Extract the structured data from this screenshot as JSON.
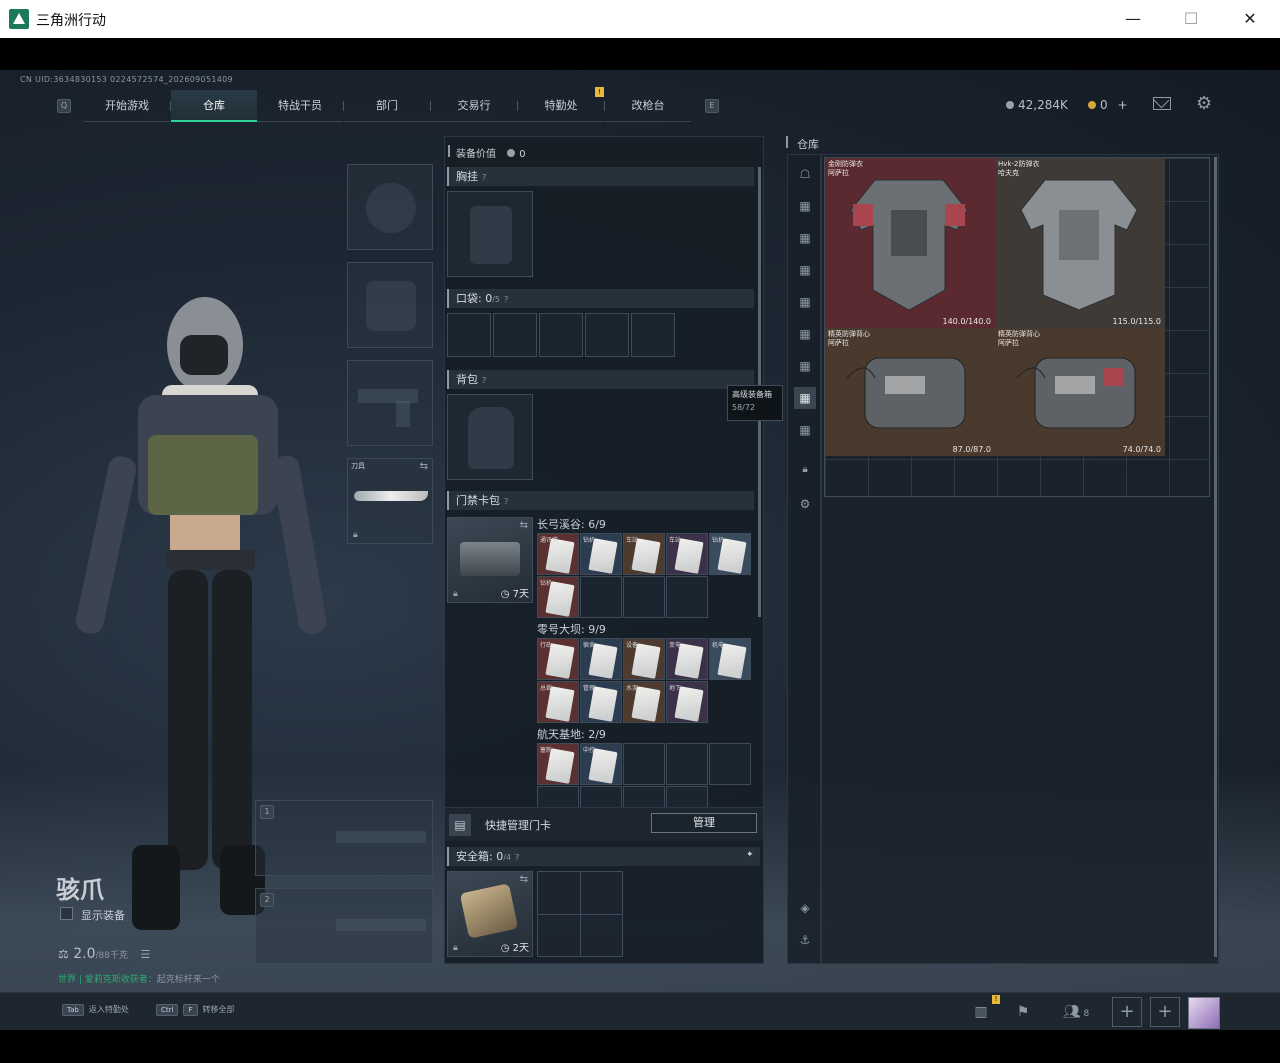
{
  "window": {
    "title": "三角洲行动",
    "controls": {
      "minimize": "—",
      "maximize": "☐",
      "close": "✕"
    }
  },
  "uid": "CN UID:3634830153 0224572574_202609051409",
  "nav": {
    "left_key": "Q",
    "right_key": "E",
    "tabs": [
      "开始游戏",
      "仓库",
      "特战干员",
      "部门",
      "交易行",
      "特勤处",
      "改枪台"
    ],
    "active_tab": "仓库",
    "notify_badge": "!"
  },
  "currency": {
    "hafcoin": "42,284K",
    "coupons": "0",
    "plus": "+"
  },
  "operator": {
    "name": "骇爪",
    "show_gear_label": "显示装备",
    "weight": "2.0",
    "weight_max": "/88千克",
    "chat_line_green": "世界 | 爱莉克斯收获者：",
    "chat_line_gray": "起克标杆来一个"
  },
  "slots": {
    "melee_label": "刀具",
    "weapon_slot_1": "1",
    "weapon_slot_2": "2"
  },
  "loadout": {
    "equipment_value_label": "装备价值",
    "equipment_value": "0",
    "chest_rig": "胸挂",
    "pockets_label": "口袋:",
    "pockets_count": "0",
    "pockets_max": "/5",
    "backpack": "背包",
    "keycard_bag": "门禁卡包",
    "keycard_time": "7天",
    "maps": [
      {
        "name": "长弓溪谷: 6/9",
        "cards": [
          "通讯塔",
          "钻机",
          "车站",
          "车站",
          "钻机",
          "钻机"
        ]
      },
      {
        "name": "零号大坝: 9/9",
        "cards": [
          "行政",
          "宿舍",
          "设备",
          "变电",
          "机电",
          "总裁",
          "管理",
          "水泥",
          "地下"
        ]
      },
      {
        "name": "航天基地: 2/9",
        "cards": [
          "塞新",
          "中控"
        ]
      }
    ],
    "quick_manage_label": "快捷管理门卡",
    "manage_button": "管理",
    "safe_box_label": "安全箱:",
    "safe_box_count": "0",
    "safe_box_max": "/4",
    "safe_box_time": "2天",
    "pin_icon": "📌"
  },
  "warehouse": {
    "title": "仓库",
    "tooltip": {
      "title": "高级装备箱",
      "capacity": "58/72"
    },
    "items": [
      {
        "name": "金刚防弹衣",
        "sub": "阿萨拉",
        "durability": "140.0/140.0",
        "color": "#5a2a30"
      },
      {
        "name": "Hvk-2防弹衣",
        "sub": "哈夫克",
        "durability": "115.0/115.0",
        "color": "#3f3a35"
      },
      {
        "name": "精英防弹背心",
        "sub": "阿萨拉",
        "durability": "87.0/87.0",
        "color": "#4a3a2e"
      },
      {
        "name": "精英防弹背心",
        "sub": "阿萨拉",
        "durability": "74.0/74.0",
        "color": "#4a3a2e"
      }
    ]
  },
  "bottom": {
    "hint1_key": "Tab",
    "hint1_label": "返入特勤处",
    "hint2_key1": "Ctrl",
    "hint2_key2": "F",
    "hint2_label": "转移全部",
    "friends_count": "8",
    "plus": "+"
  }
}
